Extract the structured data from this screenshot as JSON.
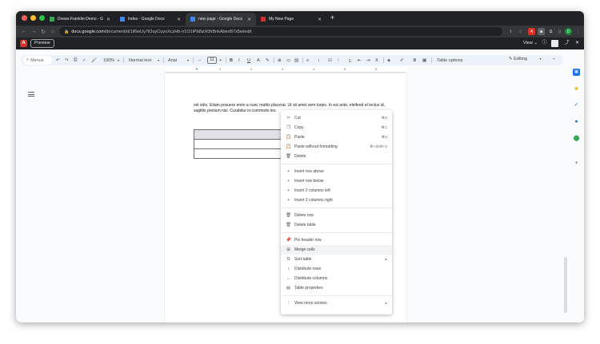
{
  "browser": {
    "tabs": [
      {
        "title": "Drews-Franklin-Demo - Goo",
        "favicon_color": "#34a853",
        "active": false
      },
      {
        "title": "Index - Google Docs",
        "favicon_color": "#4285f4",
        "active": false
      },
      {
        "title": "new page - Google Docs",
        "favicon_color": "#4285f4",
        "active": true
      },
      {
        "title": "My New Page",
        "favicon_color": "#d93025",
        "active": false
      }
    ],
    "url_host": "docs.google.com",
    "url_path": "/document/d/1ll6wUy7lOuyCuyoXczHb-n1O1iPb8izX0hBnkAbexB7x5w/edit",
    "profile_initial": "D"
  },
  "extension_bar": {
    "logo_letter": "A",
    "preview_label": "Preview",
    "view_label": "View ⌄"
  },
  "toolbar": {
    "search_menus": "Menus",
    "zoom": "100%",
    "style": "Normal text",
    "font": "Arial",
    "font_size": "11",
    "table_options": "Table options",
    "mode": "Editing"
  },
  "ruler_marks": [
    "1",
    "2",
    "3",
    "4",
    "5",
    "6"
  ],
  "document": {
    "paragraph": "vel odio. Etiam posuere enim a nunc mattis placerat. Ut sit amet sem turpis. In est ante, eleifend et lectus id, sagittis pretium nisi. Curabitur in commodo leo."
  },
  "context_menu": {
    "groups": [
      [
        {
          "icon": "✂",
          "label": "Cut",
          "shortcut": "⌘X"
        },
        {
          "icon": "❐",
          "label": "Copy",
          "shortcut": "⌘C"
        },
        {
          "icon": "📋",
          "label": "Paste",
          "shortcut": "⌘V"
        },
        {
          "icon": "📋",
          "label": "Paste without formatting",
          "shortcut": "⌘+Shift+V"
        },
        {
          "icon": "🗑",
          "label": "Delete",
          "shortcut": ""
        }
      ],
      [
        {
          "icon": "+",
          "label": "Insert row above",
          "shortcut": ""
        },
        {
          "icon": "+",
          "label": "Insert row below",
          "shortcut": ""
        },
        {
          "icon": "+",
          "label": "Insert 2 columns left",
          "shortcut": ""
        },
        {
          "icon": "+",
          "label": "Insert 2 columns right",
          "shortcut": ""
        }
      ],
      [
        {
          "icon": "🗑",
          "label": "Delete row",
          "shortcut": ""
        },
        {
          "icon": "🗑",
          "label": "Delete table",
          "shortcut": ""
        }
      ],
      [
        {
          "icon": "📌",
          "label": "Pin header row",
          "shortcut": ""
        },
        {
          "icon": "⊞",
          "label": "Merge cells",
          "shortcut": "",
          "hover": true
        },
        {
          "icon": "⇅",
          "label": "Sort table",
          "shortcut": "▸"
        },
        {
          "icon": "↕",
          "label": "Distribute rows",
          "shortcut": ""
        },
        {
          "icon": "↔",
          "label": "Distribute columns",
          "shortcut": ""
        },
        {
          "icon": "▤",
          "label": "Table properties",
          "shortcut": ""
        }
      ],
      [
        {
          "icon": "⋮",
          "label": "View more actions",
          "shortcut": "▸"
        }
      ]
    ]
  }
}
